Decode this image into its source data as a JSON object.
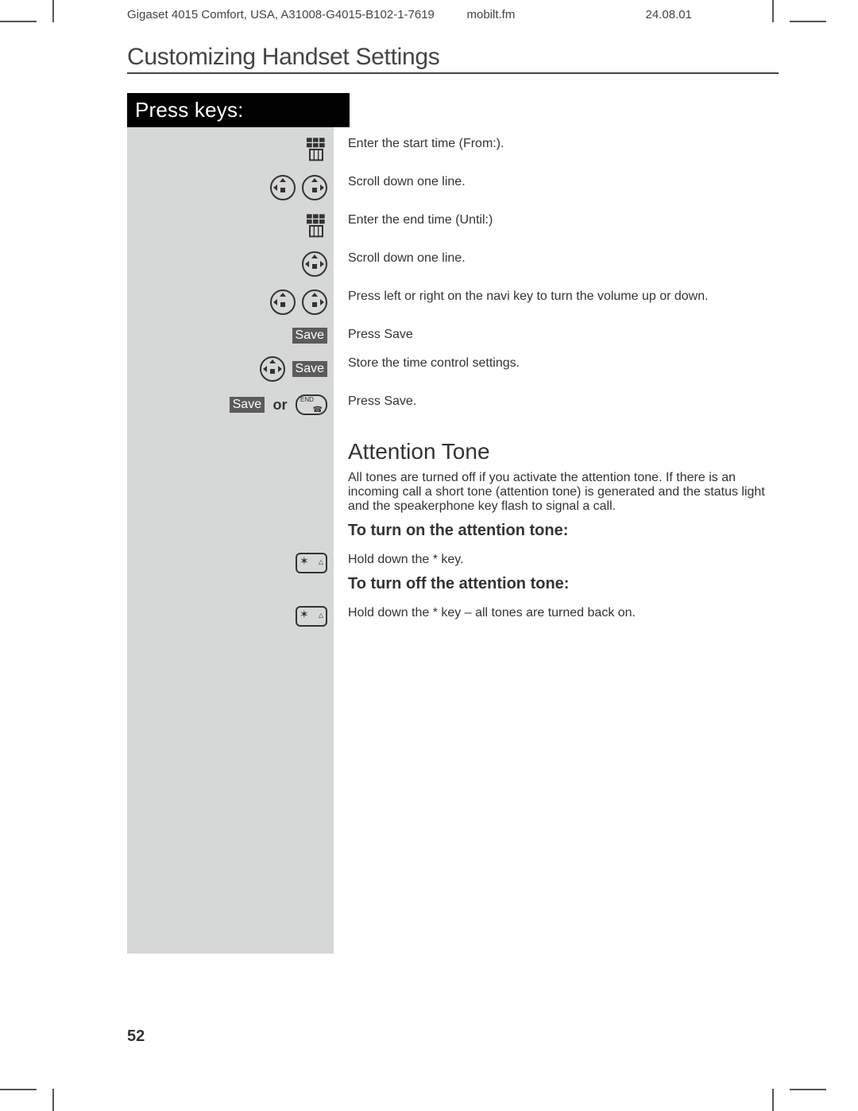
{
  "header": {
    "doc_id": "Gigaset 4015 Comfort, USA, A31008-G4015-B102-1-7619",
    "file": "mobilt.fm",
    "date": "24.08.01"
  },
  "title": "Customizing Handset Settings",
  "press_keys_label": "Press keys:",
  "save_label": "Save",
  "or_label": "or",
  "rows": {
    "r1": "Enter the start time (From:).",
    "r2": "Scroll down one line.",
    "r3": "Enter the end time (Until:)",
    "r4": "Scroll down one line.",
    "r5": "Press left or right on the navi key to turn the volume up or down.",
    "r6": "Press Save",
    "r7": "Store the time control settings.",
    "r8": "Press Save."
  },
  "attention": {
    "heading": "Attention Tone",
    "para": "All tones are turned off if you activate the attention tone. If there is an incoming call a short tone (attention tone) is generated and the status light and the speakerphone key flash to signal a call.",
    "on_label": "To turn on the attention tone:",
    "on_text": "Hold down the * key.",
    "off_label": "To turn off the attention tone:",
    "off_text": "Hold down the * key – all tones are turned back on."
  },
  "page_number": "52"
}
